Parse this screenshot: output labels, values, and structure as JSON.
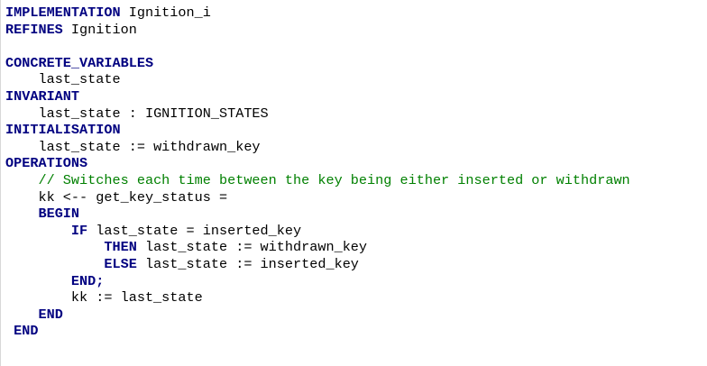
{
  "editor": {
    "lines": [
      {
        "indent": "",
        "keyword": "IMPLEMENTATION",
        "text": " Ignition_i",
        "comment": ""
      },
      {
        "indent": "",
        "keyword": "REFINES",
        "text": " Ignition",
        "comment": ""
      },
      {
        "indent": "",
        "keyword": "",
        "text": "",
        "comment": ""
      },
      {
        "indent": "",
        "keyword": "CONCRETE_VARIABLES",
        "text": "",
        "comment": ""
      },
      {
        "indent": "    ",
        "keyword": "",
        "text": "last_state",
        "comment": ""
      },
      {
        "indent": "",
        "keyword": "INVARIANT",
        "text": "",
        "comment": ""
      },
      {
        "indent": "    ",
        "keyword": "",
        "text": "last_state : IGNITION_STATES",
        "comment": ""
      },
      {
        "indent": "",
        "keyword": "INITIALISATION",
        "text": "",
        "comment": ""
      },
      {
        "indent": "    ",
        "keyword": "",
        "text": "last_state := withdrawn_key",
        "comment": ""
      },
      {
        "indent": "",
        "keyword": "OPERATIONS",
        "text": "",
        "comment": ""
      },
      {
        "indent": "    ",
        "keyword": "",
        "text": "",
        "comment": "// Switches each time between the key being either inserted or withdrawn"
      },
      {
        "indent": "    ",
        "keyword": "",
        "text": "kk <-- get_key_status =",
        "comment": ""
      },
      {
        "indent": "    ",
        "keyword": "BEGIN",
        "text": "",
        "comment": ""
      },
      {
        "indent": "        ",
        "keyword": "IF",
        "text": " last_state = inserted_key",
        "comment": ""
      },
      {
        "indent": "            ",
        "keyword": "THEN",
        "text": " last_state := withdrawn_key",
        "comment": ""
      },
      {
        "indent": "            ",
        "keyword": "ELSE",
        "text": " last_state := inserted_key",
        "comment": ""
      },
      {
        "indent": "        ",
        "keyword": "END;",
        "text": "",
        "comment": ""
      },
      {
        "indent": "        ",
        "keyword": "",
        "text": "kk := last_state",
        "comment": ""
      },
      {
        "indent": "    ",
        "keyword": "END",
        "text": "",
        "comment": ""
      },
      {
        "indent": " ",
        "keyword": "END",
        "text": "",
        "comment": ""
      }
    ]
  },
  "colors": {
    "keyword": "#000080",
    "plain": "#000000",
    "comment": "#008000",
    "background": "#ffffff"
  }
}
